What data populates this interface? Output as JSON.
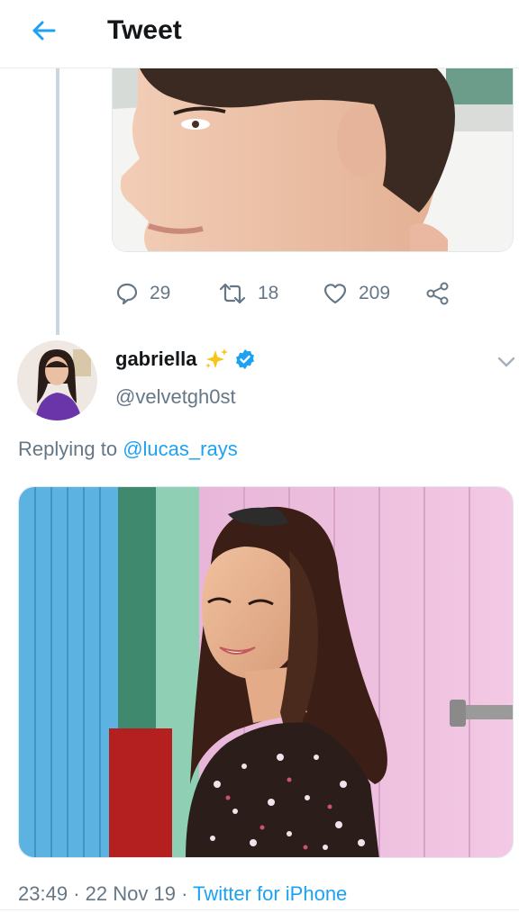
{
  "header": {
    "title": "Tweet",
    "back_icon": "arrow-left-icon"
  },
  "colors": {
    "accent": "#1da1f2",
    "muted": "#657786",
    "text": "#14171a",
    "verified": "#1da1f2",
    "divider": "#e6ecf0"
  },
  "parent_tweet": {
    "actions": {
      "reply_count": "29",
      "retweet_count": "18",
      "like_count": "209",
      "icons": [
        "reply-icon",
        "retweet-icon",
        "like-icon",
        "share-icon"
      ]
    }
  },
  "tweet": {
    "display_name": "gabriella",
    "emoji": "✨",
    "handle": "@velvetgh0st",
    "replying_prefix": "Replying to",
    "replying_to": "@lucas_rays",
    "time": "23:49",
    "sep1": "·",
    "date": "22 Nov 19",
    "sep2": "·",
    "source": "Twitter for iPhone"
  }
}
